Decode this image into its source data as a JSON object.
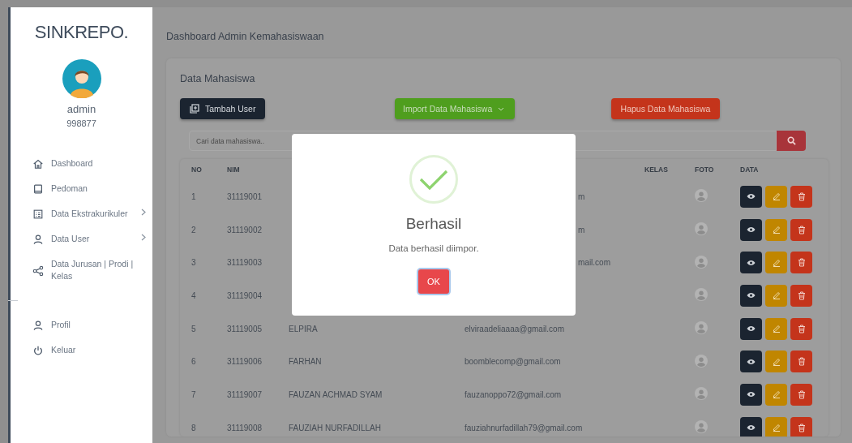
{
  "sidebar": {
    "logo": "SINKREPO.",
    "user_name": "admin",
    "user_id": "998877",
    "menu": [
      {
        "label": "Dashboard",
        "has_submenu": false
      },
      {
        "label": "Pedoman",
        "has_submenu": false
      },
      {
        "label": "Data Ekstrakurikuler",
        "has_submenu": true
      },
      {
        "label": "Data User",
        "has_submenu": true
      },
      {
        "label": "Data Jurusan | Prodi | Kelas",
        "has_submenu": false
      }
    ],
    "footer_menu": [
      {
        "label": "Profil"
      },
      {
        "label": "Keluar"
      }
    ]
  },
  "header": {
    "title": "Dashboard Admin Kemahasiswaan"
  },
  "card": {
    "title": "Data Mahasiswa",
    "buttons": [
      {
        "label": "Tambah User",
        "kind": "add"
      },
      {
        "label": "Import Data Mahasiswa",
        "kind": "import"
      },
      {
        "label": "Hapus Data Mahasiswa",
        "kind": "delete"
      }
    ],
    "search": {
      "placeholder": "Cari data mahasiswa.."
    }
  },
  "table": {
    "columns": {
      "no": "NO",
      "nim": "NIM",
      "kelas": "KELAS",
      "foto": "FOTO",
      "data": "DATA"
    },
    "rows": [
      {
        "no": "1",
        "nim": "31119001",
        "email": "m",
        "kind": "covered"
      },
      {
        "no": "2",
        "nim": "31119002",
        "email": "m",
        "kind": "covered"
      },
      {
        "no": "3",
        "nim": "31119003",
        "email": "mail.com",
        "kind": "covered"
      },
      {
        "no": "4",
        "nim": "31119004",
        "kind": "covered"
      },
      {
        "no": "5",
        "nim": "31119005",
        "name": "ELPIRA",
        "email": "elviraadeliaaaa@gmail.com",
        "kind": "full"
      },
      {
        "no": "6",
        "nim": "31119006",
        "name": "FARHAN",
        "email": "boomblecomp@gmail.com",
        "kind": "full"
      },
      {
        "no": "7",
        "nim": "31119007",
        "name": "FAUZAN ACHMAD SYAM",
        "email": "fauzanoppo72@gmail.com",
        "kind": "full"
      },
      {
        "no": "8",
        "nim": "31119008",
        "name": "FAUZIAH NURFADILLAH",
        "email": "fauziahnurfadillah79@gmail.com",
        "kind": "full"
      }
    ]
  },
  "modal": {
    "title": "Berhasil",
    "message": "Data berhasil diimpor.",
    "button": "OK"
  }
}
